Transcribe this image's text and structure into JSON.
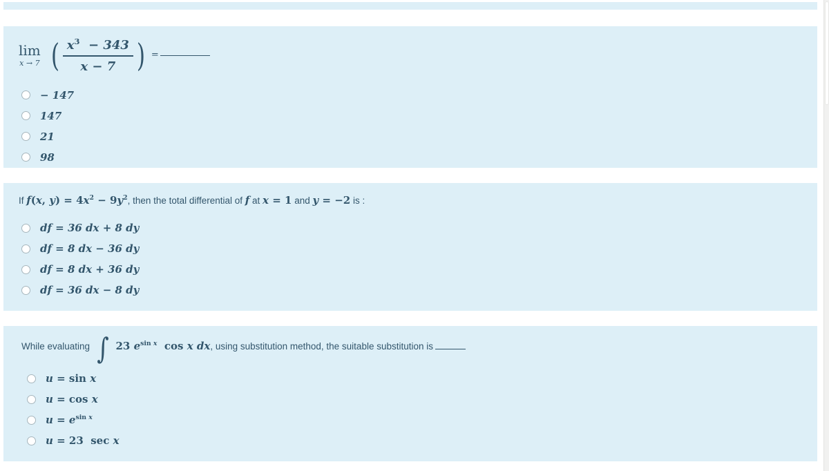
{
  "document": {
    "type": "multiple-choice-quiz",
    "card_color": "#ddeff7",
    "text_color": "#33566c",
    "page_background": "#ffffff"
  },
  "partial_card_top": {
    "visible": true
  },
  "questions": [
    {
      "id": "q1",
      "prompt_parts": {
        "lim_label": "lim",
        "lim_sub": "x → 7",
        "numerator": "x³ − 343",
        "denominator": "x − 7",
        "equals": "=",
        "blank": "________"
      },
      "prompt_plain": "lim x→7 ( (x³ − 343) / (x − 7) ) = ________",
      "options": [
        {
          "label": "− 147",
          "selected": false
        },
        {
          "label": "147",
          "selected": false
        },
        {
          "label": "21",
          "selected": false
        },
        {
          "label": "98",
          "selected": false
        }
      ]
    },
    {
      "id": "q2",
      "prompt_plain": "If f(x, y) = 4x² − 9y², then the total differential of f at x = 1 and y = −2 is :",
      "prompt_parts": {
        "lead": "If",
        "function": "f(x, y) = 4x² − 9y²",
        "middle": ", then the total differential of",
        "f": "f",
        "at": "at",
        "x_val": "x = 1",
        "and": "and",
        "y_val": "y = −2",
        "tail": "is :"
      },
      "options": [
        {
          "label": "df = 36 dx + 8 dy",
          "selected": false
        },
        {
          "label": "df = 8 dx − 36 dy",
          "selected": false
        },
        {
          "label": "df = 8 dx + 36 dy",
          "selected": false
        },
        {
          "label": "df = 36 dx − 8 dy",
          "selected": false
        }
      ]
    },
    {
      "id": "q3",
      "prompt_plain": "While evaluating ∫ 23 e^(sin x) cos x dx, using substitution method, the suitable substitution is _____",
      "prompt_parts": {
        "lead": "While evaluating",
        "integral": "∫ 23 e^{sin x} cos x dx",
        "integrand_coefficient": "23",
        "integrand_exp_base": "e",
        "integrand_exp_power": "sin x",
        "integrand_trig": "cos x",
        "integrand_diff": "dx",
        "middle": ", using substitution method, the suitable substitution is",
        "blank": "_____"
      },
      "options": [
        {
          "label": "u = sin x",
          "selected": false
        },
        {
          "label": "u = cos x",
          "selected": false
        },
        {
          "label": "u = e^{sin x}",
          "selected": false
        },
        {
          "label": "u = 23 sec x",
          "selected": false
        }
      ]
    }
  ],
  "icons": {
    "radio": "radio-button-unchecked"
  }
}
